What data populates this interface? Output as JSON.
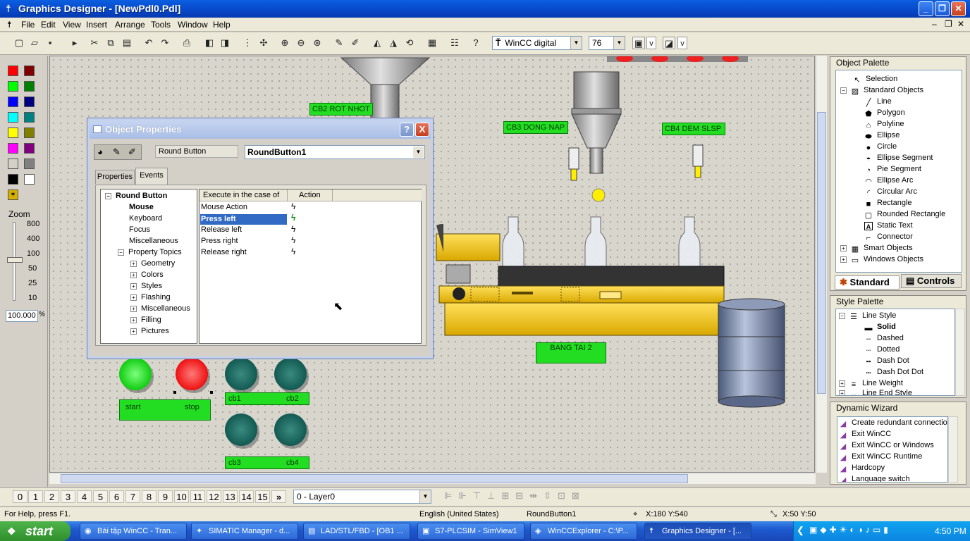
{
  "window": {
    "title": "Graphics Designer - [NewPdl0.Pdl]"
  },
  "menu": [
    "File",
    "Edit",
    "View",
    "Insert",
    "Arrange",
    "Tools",
    "Window",
    "Help"
  ],
  "toolbar": {
    "font_combo": "WinCC digital",
    "size_combo": "76",
    "v1": "v",
    "v2": "v"
  },
  "zoom": {
    "label": "Zoom",
    "ticks": [
      "800",
      "400",
      "100",
      "50",
      "25",
      "10"
    ],
    "value": "100.000",
    "unit": "%"
  },
  "canvas": {
    "labels": {
      "cb2rot": "CB2 ROT NHOT",
      "cb3": "CB3 DONG NAP",
      "cb4": "CB4 DEM SLSP",
      "bangtai": "BANG TAI 2",
      "start": "start",
      "stop": "stop",
      "cb1": "cb1",
      "cb2": "cb2",
      "cb3b": "cb3",
      "cb4b": "cb4"
    }
  },
  "dialog": {
    "title": "Object Properties",
    "help": "?",
    "close": "X",
    "object_type": "Round Button",
    "object_name": "RoundButton1",
    "tabs": [
      "Properties",
      "Events"
    ],
    "tree": {
      "root": "Round Button",
      "items": [
        "Mouse",
        "Keyboard",
        "Focus",
        "Miscellaneous",
        "Property Topics"
      ],
      "topics": [
        "Geometry",
        "Colors",
        "Styles",
        "Flashing",
        "Miscellaneous",
        "Filling",
        "Pictures"
      ]
    },
    "columns": [
      "Execute in the case of",
      "Action"
    ],
    "events": [
      "Mouse Action",
      "Press left",
      "Release left",
      "Press right",
      "Release right"
    ]
  },
  "object_palette": {
    "title": "Object Palette",
    "items": [
      "Selection",
      "Standard Objects",
      "Line",
      "Polygon",
      "Polyline",
      "Ellipse",
      "Circle",
      "Ellipse Segment",
      "Pie Segment",
      "Ellipse Arc",
      "Circular Arc",
      "Rectangle",
      "Rounded Rectangle",
      "Static Text",
      "Connector",
      "Smart Objects",
      "Windows Objects"
    ],
    "tabs": [
      "Standard",
      "Controls"
    ]
  },
  "style_palette": {
    "title": "Style Palette",
    "items": [
      "Line Style",
      "Solid",
      "Dashed",
      "Dotted",
      "Dash Dot",
      "Dash Dot Dot",
      "Line Weight",
      "Line End Style"
    ]
  },
  "dynamic_wizard": {
    "title": "Dynamic Wizard",
    "items": [
      "Create redundant connection",
      "Exit WinCC",
      "Exit WinCC or Windows",
      "Exit WinCC Runtime",
      "Hardcopy",
      "Language switch"
    ]
  },
  "layers": {
    "numbers": [
      "0",
      "1",
      "2",
      "3",
      "4",
      "5",
      "6",
      "7",
      "8",
      "9",
      "10",
      "11",
      "12",
      "13",
      "14",
      "15"
    ],
    "more": "»",
    "combo": "0 - Layer0"
  },
  "status": {
    "help": "For Help, press F1.",
    "lang": "English (United States)",
    "object": "RoundButton1",
    "pos": "X:180 Y:540",
    "size": "X:50 Y:50"
  },
  "taskbar": {
    "start": "start",
    "tasks": [
      "Bài tập WinCC - Tran...",
      "SIMATIC Manager - d...",
      "LAD/STL/FBD - [OB1 ...",
      "S7-PLCSIM - SimView1",
      "WinCCExplorer - C:\\P...",
      "Graphics Designer - [..."
    ],
    "clock": "4:50 PM"
  }
}
